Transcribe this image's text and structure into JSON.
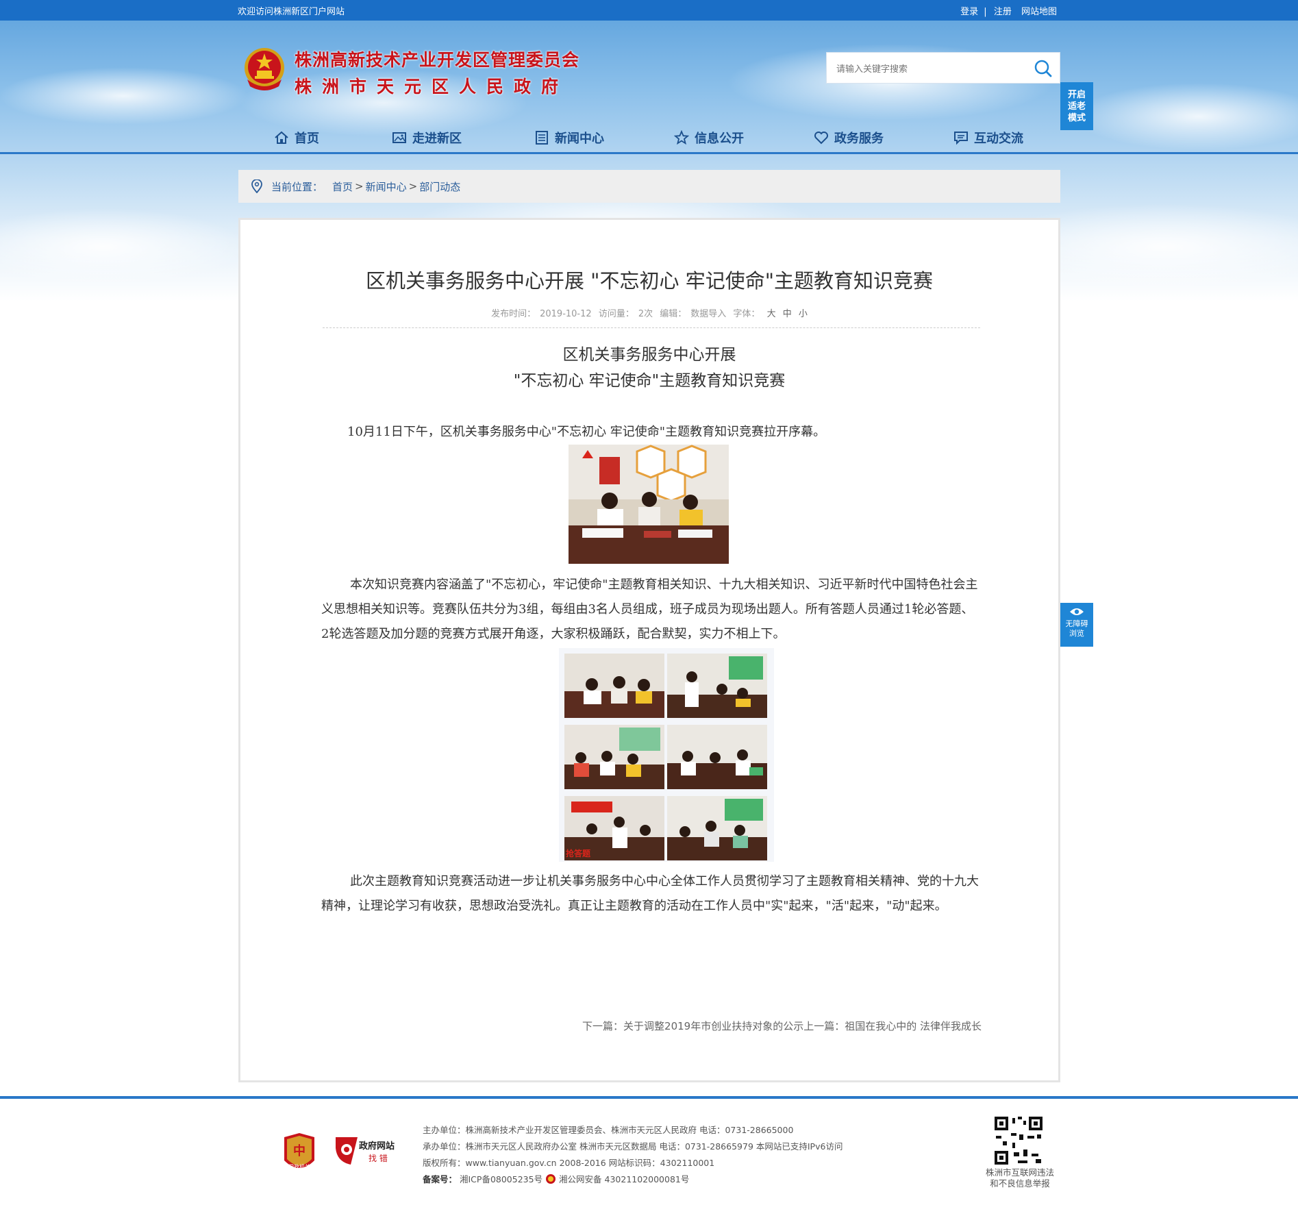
{
  "topbar": {
    "welcome": "欢迎访问株洲新区门户网站",
    "login": "登录",
    "register": "注册",
    "sitemap": "网站地图",
    "separator": "|"
  },
  "header": {
    "title_line1": "株洲高新技术产业开发区管理委员会",
    "title_line2": "株洲市天元区人民政府",
    "search_placeholder": "请输入关键字搜索",
    "elder_mode": [
      "开启",
      "适老",
      "模式"
    ]
  },
  "nav": {
    "items": [
      {
        "label": "首页",
        "icon": "home-icon"
      },
      {
        "label": "走进新区",
        "icon": "picture-icon"
      },
      {
        "label": "新闻中心",
        "icon": "news-icon"
      },
      {
        "label": "信息公开",
        "icon": "star-icon"
      },
      {
        "label": "政务服务",
        "icon": "heart-icon"
      },
      {
        "label": "互动交流",
        "icon": "chat-icon"
      }
    ]
  },
  "breadcrumb": {
    "label": "当前位置：",
    "items": [
      "首页",
      "新闻中心",
      "部门动态"
    ],
    "separator": ">"
  },
  "article": {
    "title": "区机关事务服务中心开展 \"不忘初心 牢记使命\"主题教育知识竞赛",
    "meta": {
      "publish_label": "发布时间：",
      "publish_date": "2019-10-12",
      "views_label": "访问量：",
      "views": "2次",
      "editor_label": "编辑：",
      "editor": "数据导入",
      "font_label": "字体：",
      "font_large": "大",
      "font_medium": "中",
      "font_small": "小"
    },
    "subhead_line1": "区机关事务服务中心开展",
    "subhead_line2": "\"不忘初心 牢记使命\"主题教育知识竞赛",
    "para1": "10月11日下午，区机关事务服务中心\"不忘初心 牢记使命\"主题教育知识竞赛拉开序幕。",
    "para2": "本次知识竞赛内容涵盖了\"不忘初心，牢记使命\"主题教育相关知识、十九大相关知识、习近平新时代中国特色社会主义思想相关知识等。竞赛队伍共分为3组，每组由3名人员组成，班子成员为现场出题人。所有答题人员通过1轮必答题、2轮选答题及加分题的竞赛方式展开角逐，大家积极踊跃，配合默契，实力不相上下。",
    "para3": "此次主题教育知识竞赛活动进一步让机关事务服务中心中心全体工作人员贯彻学习了主题教育相关精神、党的十九大精神，让理论学习有收获，思想政治受洗礼。真正让主题教育的活动在工作人员中\"实\"起来，\"活\"起来，\"动\"起来。",
    "prev_next": "下一篇：关于调整2019年市创业扶持对象的公示上一篇：祖国在我心中的 法律伴我成长",
    "collage_caption": "抢答题"
  },
  "side": {
    "a11y_line1": "无障碍",
    "a11y_line2": "浏览"
  },
  "footer": {
    "sponsor": "主办单位：株洲高新技术产业开发区管理委员会、株洲市天元区人民政府 电话：0731-28665000",
    "organizer": "承办单位：株洲市天元区人民政府办公室 株洲市天元区数据局 电话：0731-28665979 本网站已支持IPv6访问",
    "copyright": "版权所有：www.tianyuan.gov.cn 2008-2016 网站标识码：4302110001",
    "record_label": "备案号：",
    "icp": "湘ICP备08005235号",
    "police": "湘公网安备 43021102000081号",
    "dang_label": "党政机关",
    "zfwz_line1": "政府网站",
    "zfwz_line2": "找 错",
    "qr_line1": "株洲市互联网违法",
    "qr_line2": "和不良信息举报"
  },
  "colors": {
    "topbar": "#1a6ec6",
    "nav_text": "#1b4f8c",
    "title_red": "#c8141b",
    "accent_blue": "#1f86d6"
  }
}
